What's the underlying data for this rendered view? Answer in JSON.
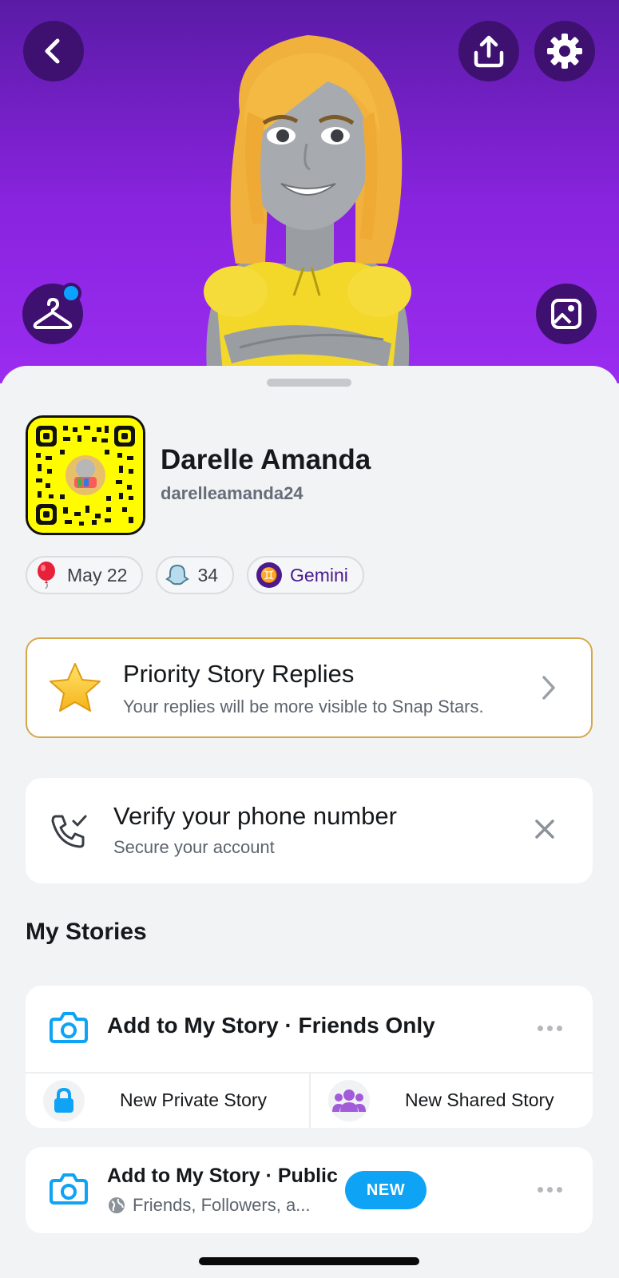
{
  "header": {
    "icons": [
      "back-icon",
      "share-icon",
      "settings-icon",
      "outfit-icon",
      "photo-icon"
    ],
    "accent_color": "#8a24e0"
  },
  "profile": {
    "display_name": "Darelle Amanda",
    "username": "darelleamanda24",
    "chips": {
      "birthday": "May 22",
      "snapscore": "34",
      "zodiac_symbol": "♊",
      "zodiac": "Gemini"
    }
  },
  "priority": {
    "title": "Priority Story Replies",
    "subtitle": "Your replies will be more visible to Snap Stars."
  },
  "verify": {
    "title": "Verify your phone number",
    "subtitle": "Secure your account"
  },
  "stories": {
    "section_title": "My Stories",
    "friends_only": "Add to My Story · Friends Only",
    "new_private": "New Private Story",
    "new_shared": "New Shared Story",
    "public_title": "Add to My Story · Public",
    "public_sub": "Friends, Followers, a...",
    "new_badge": "NEW"
  }
}
